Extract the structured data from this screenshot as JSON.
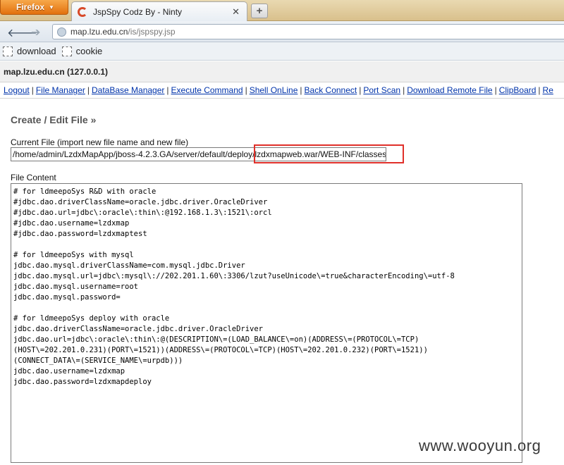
{
  "browser": {
    "app_button": "Firefox",
    "tab_title": "JspSpy Codz By - Ninty",
    "url_host": "map.lzu.edu.cn",
    "url_path": "/is/jspspy.jsp",
    "bookmarks": [
      "download",
      "cookie"
    ]
  },
  "page": {
    "host": "map.lzu.edu.cn (127.0.0.1)",
    "menu": [
      "Logout",
      "File Manager",
      "DataBase Manager",
      "Execute Command",
      "Shell OnLine",
      "Back Connect",
      "Port Scan",
      "Download Remote File",
      "ClipBoard",
      "Re"
    ],
    "section_title": "Create / Edit File »",
    "current_file_label": "Current File (import new file name and new file)",
    "current_file_value": "/home/admin/LzdxMapApp/jboss-4.2.3.GA/server/default/deploy/lzdxmapweb.war/WEB-INF/classes",
    "file_content_label": "File Content",
    "file_content_lines": [
      "# for ldmeepoSys R&D with oracle",
      "#jdbc.dao.driverClassName=oracle.jdbc.driver.OracleDriver",
      "#jdbc.dao.url=jdbc\\:oracle\\:thin\\:@192.168.1.3\\:1521\\:orcl",
      "#jdbc.dao.username=lzdxmap",
      "#jdbc.dao.password=lzdxmaptest",
      "",
      "# for ldmeepoSys with mysql",
      "jdbc.dao.mysql.driverClassName=com.mysql.jdbc.Driver",
      "jdbc.dao.mysql.url=jdbc\\:mysql\\://202.201.1.60\\:3306/lzut?useUnicode\\=true&characterEncoding\\=utf-8",
      "jdbc.dao.mysql.username=root",
      "jdbc.dao.mysql.password=",
      "",
      "# for ldmeepoSys deploy with oracle",
      "jdbc.dao.driverClassName=oracle.jdbc.driver.OracleDriver",
      "jdbc.dao.url=jdbc\\:oracle\\:thin\\:@(DESCRIPTION\\=(LOAD_BALANCE\\=on)(ADDRESS\\=(PROTOCOL\\=TCP)",
      "(HOST\\=202.201.0.231)(PORT\\=1521))(ADDRESS\\=(PROTOCOL\\=TCP)(HOST\\=202.201.0.232)(PORT\\=1521))",
      "(CONNECT_DATA\\=(SERVICE_NAME\\=urpdb)))",
      "jdbc.dao.username=lzdxmap",
      "jdbc.dao.password=lzdxmapdeploy"
    ]
  },
  "watermark": "www.wooyun.org",
  "colors": {
    "highlight": "#e0302a",
    "link": "#0033aa",
    "firefox_orange": "#e2700d"
  }
}
